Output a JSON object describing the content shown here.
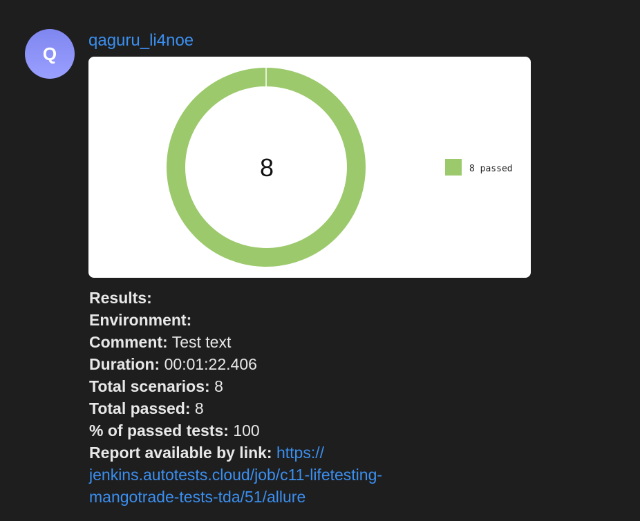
{
  "message": {
    "avatar_letter": "Q",
    "sender": "qaguru_li4noe",
    "colors": {
      "background": "#1e1e1e",
      "accent_link": "#3b8ff0",
      "avatar_gradient_top": "#7f86ef",
      "passed_green": "#9bc96b"
    },
    "report_image": {
      "center_total": "8",
      "legend_label": "8 passed"
    },
    "lines": {
      "results_label": "Results:",
      "environment_label": "Environment:",
      "comment_label": "Comment:",
      "comment_value": " Test text",
      "duration_label": "Duration:",
      "duration_value": " 00:01:22.406",
      "total_scenarios_label": "Total scenarios:",
      "total_scenarios_value": " 8",
      "total_passed_label": "Total passed:",
      "total_passed_value": " 8",
      "percent_label": "% of passed tests:",
      "percent_value": " 100",
      "report_label": "Report available by link:",
      "report_link_part1": "https://",
      "report_link_part2": "jenkins.autotests.cloud/job/c11-lifetesting-",
      "report_link_part3": "mangotrade-tests-tda/51/allure"
    }
  },
  "chart_data": {
    "type": "pie",
    "categories": [
      "passed"
    ],
    "values": [
      8
    ],
    "colors": [
      "#9bc96b"
    ],
    "donut": true,
    "center_label": "8",
    "legend": [
      "8 passed"
    ],
    "legend_position": "right"
  }
}
